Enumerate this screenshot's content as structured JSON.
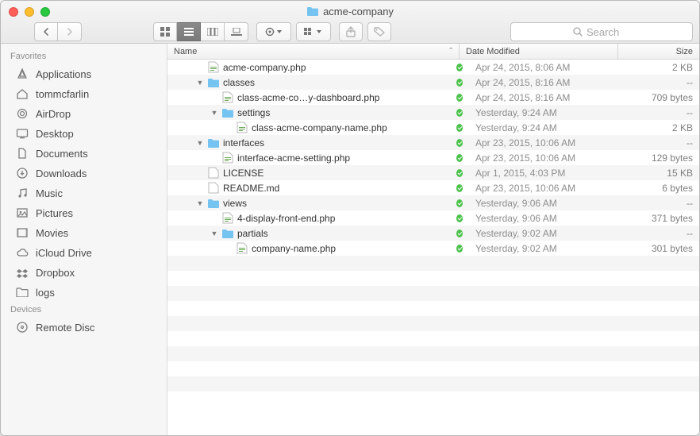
{
  "window": {
    "title": "acme-company",
    "title_icon": "folder-icon"
  },
  "toolbar": {
    "search_placeholder": "Search"
  },
  "sidebar": {
    "sections": [
      {
        "title": "Favorites",
        "items": [
          {
            "icon": "apps-icon",
            "label": "Applications"
          },
          {
            "icon": "home-icon",
            "label": "tommcfarlin"
          },
          {
            "icon": "airdrop-icon",
            "label": "AirDrop"
          },
          {
            "icon": "desktop-icon",
            "label": "Desktop"
          },
          {
            "icon": "documents-icon",
            "label": "Documents"
          },
          {
            "icon": "downloads-icon",
            "label": "Downloads"
          },
          {
            "icon": "music-icon",
            "label": "Music"
          },
          {
            "icon": "pictures-icon",
            "label": "Pictures"
          },
          {
            "icon": "movies-icon",
            "label": "Movies"
          },
          {
            "icon": "icloud-icon",
            "label": "iCloud Drive"
          },
          {
            "icon": "dropbox-icon",
            "label": "Dropbox"
          },
          {
            "icon": "folder-icon",
            "label": "logs"
          }
        ]
      },
      {
        "title": "Devices",
        "items": [
          {
            "icon": "disc-icon",
            "label": "Remote Disc"
          }
        ]
      }
    ]
  },
  "columns": {
    "name": "Name",
    "date": "Date Modified",
    "size": "Size"
  },
  "rows": [
    {
      "indent": 0,
      "disclosure": "",
      "icon": "php",
      "name": "acme-company.php",
      "date": "Apr 24, 2015, 8:06 AM",
      "size": "2 KB"
    },
    {
      "indent": 0,
      "disclosure": "down",
      "icon": "folder",
      "name": "classes",
      "date": "Apr 24, 2015, 8:16 AM",
      "size": "--"
    },
    {
      "indent": 1,
      "disclosure": "",
      "icon": "php",
      "name": "class-acme-co…y-dashboard.php",
      "date": "Apr 24, 2015, 8:16 AM",
      "size": "709 bytes"
    },
    {
      "indent": 1,
      "disclosure": "down",
      "icon": "folder",
      "name": "settings",
      "date": "Yesterday, 9:24 AM",
      "size": "--"
    },
    {
      "indent": 2,
      "disclosure": "",
      "icon": "php",
      "name": "class-acme-company-name.php",
      "date": "Yesterday, 9:24 AM",
      "size": "2 KB"
    },
    {
      "indent": 0,
      "disclosure": "down",
      "icon": "folder",
      "name": "interfaces",
      "date": "Apr 23, 2015, 10:06 AM",
      "size": "--"
    },
    {
      "indent": 1,
      "disclosure": "",
      "icon": "php",
      "name": "interface-acme-setting.php",
      "date": "Apr 23, 2015, 10:06 AM",
      "size": "129 bytes"
    },
    {
      "indent": 0,
      "disclosure": "",
      "icon": "doc",
      "name": "LICENSE",
      "date": "Apr 1, 2015, 4:03 PM",
      "size": "15 KB"
    },
    {
      "indent": 0,
      "disclosure": "",
      "icon": "doc",
      "name": "README.md",
      "date": "Apr 23, 2015, 10:06 AM",
      "size": "6 bytes"
    },
    {
      "indent": 0,
      "disclosure": "down",
      "icon": "folder",
      "name": "views",
      "date": "Yesterday, 9:06 AM",
      "size": "--"
    },
    {
      "indent": 1,
      "disclosure": "",
      "icon": "php",
      "name": "4-display-front-end.php",
      "date": "Yesterday, 9:06 AM",
      "size": "371 bytes"
    },
    {
      "indent": 1,
      "disclosure": "down",
      "icon": "folder",
      "name": "partials",
      "date": "Yesterday, 9:02 AM",
      "size": "--"
    },
    {
      "indent": 2,
      "disclosure": "",
      "icon": "php",
      "name": "company-name.php",
      "date": "Yesterday, 9:02 AM",
      "size": "301 bytes"
    }
  ],
  "icon_labels": {
    "php": "php-file-icon",
    "folder": "folder-icon",
    "doc": "document-icon"
  }
}
